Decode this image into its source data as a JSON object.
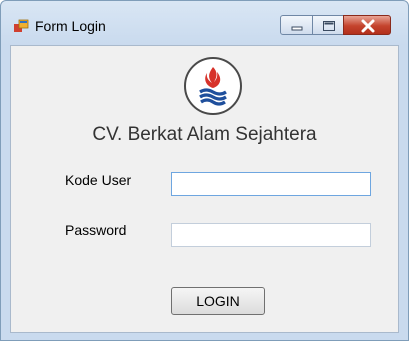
{
  "window": {
    "title": "Form Login"
  },
  "icons": {
    "app": "form-app-icon",
    "logo": "flame-waves-logo",
    "min": "minimize-icon",
    "max": "maximize-icon",
    "close": "close-icon"
  },
  "colors": {
    "logo_red": "#d7322a",
    "logo_blue": "#1f4f9c",
    "close_red": "#c4432d"
  },
  "header": {
    "company": "CV. Berkat Alam Sejahtera"
  },
  "form": {
    "user_label": "Kode User",
    "user_value": "",
    "password_label": "Password",
    "password_value": "",
    "login_label": "LOGIN"
  }
}
